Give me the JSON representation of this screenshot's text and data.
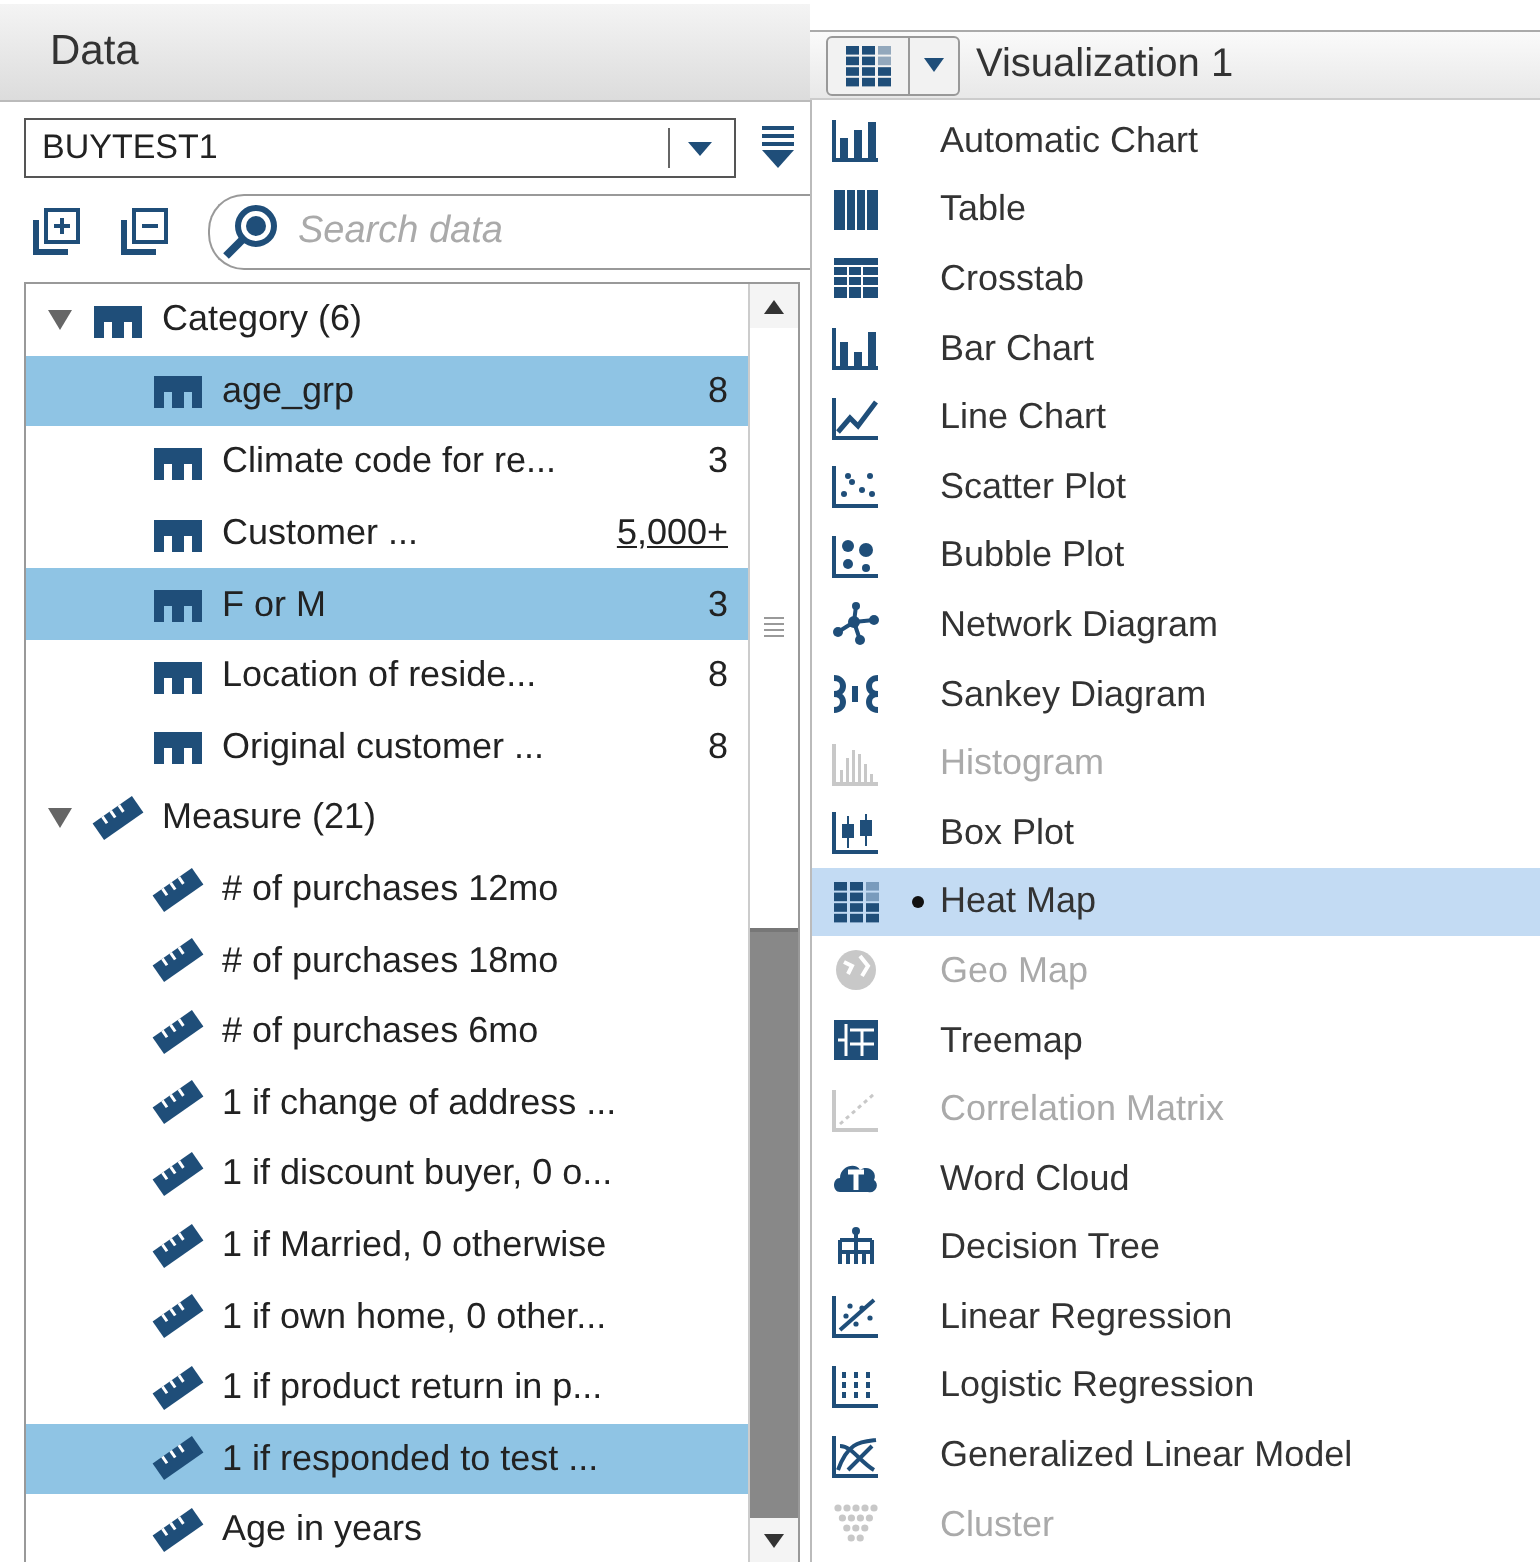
{
  "data_panel": {
    "title": "Data",
    "data_source": {
      "value": "BUYTEST1"
    },
    "search": {
      "placeholder": "Search data"
    },
    "groups": [
      {
        "label": "Category (6)",
        "kind": "category",
        "expanded": true,
        "items": [
          {
            "label": "age_grp",
            "count": "8",
            "link": false,
            "selected": true
          },
          {
            "label": "Climate code for re...",
            "count": "3",
            "link": false,
            "selected": false
          },
          {
            "label": "Customer ...",
            "count": "5,000+",
            "link": true,
            "selected": false
          },
          {
            "label": "F or M",
            "count": "3",
            "link": false,
            "selected": true
          },
          {
            "label": "Location of reside...",
            "count": "8",
            "link": false,
            "selected": false
          },
          {
            "label": "Original customer ...",
            "count": "8",
            "link": false,
            "selected": false
          }
        ]
      },
      {
        "label": "Measure (21)",
        "kind": "measure",
        "expanded": true,
        "items": [
          {
            "label": "# of purchases 12mo",
            "selected": false
          },
          {
            "label": "# of purchases 18mo",
            "selected": false
          },
          {
            "label": "# of purchases 6mo",
            "selected": false
          },
          {
            "label": "1 if change of address ...",
            "selected": false
          },
          {
            "label": "1 if discount buyer, 0 o...",
            "selected": false
          },
          {
            "label": "1 if Married, 0 otherwise",
            "selected": false
          },
          {
            "label": "1 if own home, 0 other...",
            "selected": false
          },
          {
            "label": "1 if product return in p...",
            "selected": false
          },
          {
            "label": "1 if responded to test ...",
            "selected": true
          },
          {
            "label": "Age in years",
            "selected": false
          }
        ]
      }
    ]
  },
  "visualization": {
    "title": "Visualization 1",
    "menu": [
      {
        "label": "Automatic Chart",
        "kind": "auto",
        "disabled": false,
        "selected": false
      },
      {
        "label": "Table",
        "kind": "table",
        "disabled": false,
        "selected": false
      },
      {
        "label": "Crosstab",
        "kind": "crosstab",
        "disabled": false,
        "selected": false
      },
      {
        "label": "Bar Chart",
        "kind": "bar",
        "disabled": false,
        "selected": false
      },
      {
        "label": "Line Chart",
        "kind": "line",
        "disabled": false,
        "selected": false
      },
      {
        "label": "Scatter Plot",
        "kind": "scatter",
        "disabled": false,
        "selected": false
      },
      {
        "label": "Bubble Plot",
        "kind": "bubble",
        "disabled": false,
        "selected": false
      },
      {
        "label": "Network Diagram",
        "kind": "network",
        "disabled": false,
        "selected": false
      },
      {
        "label": "Sankey Diagram",
        "kind": "sankey",
        "disabled": false,
        "selected": false
      },
      {
        "label": "Histogram",
        "kind": "histogram",
        "disabled": true,
        "selected": false
      },
      {
        "label": "Box Plot",
        "kind": "box",
        "disabled": false,
        "selected": false
      },
      {
        "label": "Heat Map",
        "kind": "heatmap",
        "disabled": false,
        "selected": true
      },
      {
        "label": "Geo Map",
        "kind": "geo",
        "disabled": true,
        "selected": false
      },
      {
        "label": "Treemap",
        "kind": "treemap",
        "disabled": false,
        "selected": false
      },
      {
        "label": "Correlation Matrix",
        "kind": "correlation",
        "disabled": true,
        "selected": false
      },
      {
        "label": "Word Cloud",
        "kind": "cloud",
        "disabled": false,
        "selected": false
      },
      {
        "label": "Decision Tree",
        "kind": "tree",
        "disabled": false,
        "selected": false
      },
      {
        "label": "Linear Regression",
        "kind": "linreg",
        "disabled": false,
        "selected": false
      },
      {
        "label": "Logistic Regression",
        "kind": "logreg",
        "disabled": false,
        "selected": false
      },
      {
        "label": "Generalized Linear Model",
        "kind": "glm",
        "disabled": false,
        "selected": false
      },
      {
        "label": "Cluster",
        "kind": "cluster",
        "disabled": true,
        "selected": false
      }
    ]
  }
}
